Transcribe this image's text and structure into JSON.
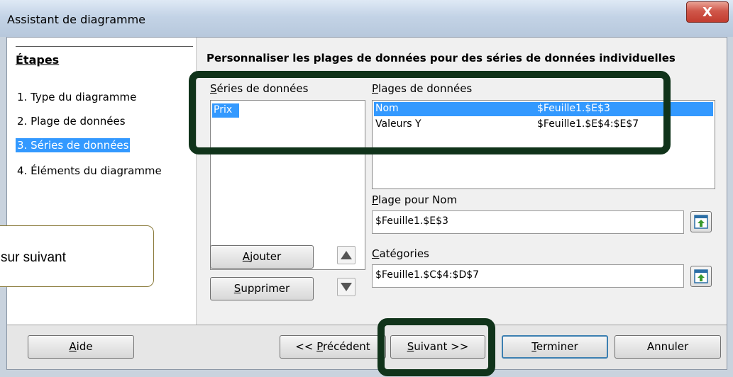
{
  "window": {
    "title": "Assistant de diagramme",
    "close_glyph": "X"
  },
  "sidebar": {
    "title": "Étapes",
    "steps": [
      {
        "label": "1. Type du diagramme",
        "selected": false
      },
      {
        "label": "2. Plage de données",
        "selected": false
      },
      {
        "label": "3. Séries de données",
        "selected": true
      },
      {
        "label": "4. Éléments du diagramme",
        "selected": false
      }
    ]
  },
  "main": {
    "heading": "Personnaliser les plages de données pour des séries de données individuelles",
    "series": {
      "label_mnemonic": "S",
      "label_rest": "éries de données",
      "items": [
        "Prix"
      ],
      "selected": "Prix"
    },
    "ranges": {
      "label_mnemonic": "P",
      "label_rest": "lages de données",
      "rows": [
        {
          "role": "Nom",
          "range": "$Feuille1.$E$3",
          "selected": true
        },
        {
          "role": "Valeurs Y",
          "range": "$Feuille1.$E$4:$E$7",
          "selected": false
        }
      ]
    },
    "name_range": {
      "label_mnemonic": "P",
      "label_rest": "lage pour Nom",
      "value": "$Feuille1.$E$3"
    },
    "categories": {
      "label_mnemonic": "C",
      "label_rest": "atégories",
      "value": "$Feuille1.$C$4:$D$7"
    },
    "add": {
      "mnemonic": "A",
      "rest": "jouter"
    },
    "remove": {
      "mnemonic": "S",
      "rest": "upprimer"
    }
  },
  "footer": {
    "help": {
      "mnemonic": "A",
      "rest": "ide"
    },
    "previous": {
      "prefix": "<< ",
      "mnemonic": "P",
      "rest": "récédent"
    },
    "next": {
      "mnemonic": "S",
      "rest": "uivant >>"
    },
    "finish": {
      "mnemonic": "T",
      "rest": "erminer"
    },
    "cancel": {
      "label": "Annuler"
    }
  },
  "callout": {
    "text": "sur suivant"
  },
  "colors": {
    "selection": "#3399ff",
    "highlight": "#10331a",
    "close": "#c23c2f"
  }
}
